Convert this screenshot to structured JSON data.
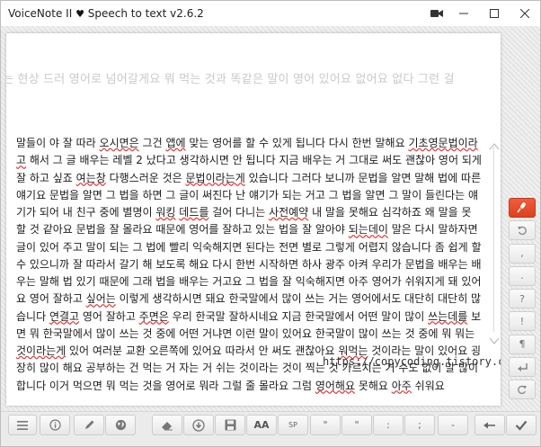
{
  "window": {
    "title_prefix": "VoiceNote II",
    "heart": "♥",
    "title_suffix": "Speech to text v2.6.2"
  },
  "editor": {
    "ghost_line": "는 현상 드러 영어로 넘어갈게요 뭐 먹는 것과 똑같은 말이 영어 있어요 없어요 없다 그런 걸",
    "segments": [
      {
        "t": "말들이 야 잘 따라 ",
        "sq": false
      },
      {
        "t": "오시면은",
        "sq": true
      },
      {
        "t": " 그건 ",
        "sq": false
      },
      {
        "t": "앱에",
        "sq": true
      },
      {
        "t": " 맞는 영어를 할 수 있게 됩니다 다시 한번 말해요 ",
        "sq": false
      },
      {
        "t": "기초영문법이라고",
        "sq": true
      },
      {
        "t": " 해서 그 글 배우는 레벨 2 났다고 생각하시면 안 됩니다 지금 배우는 거 그대로 써도 괜찮아 영어 되게 잘 하고 싶죠 ",
        "sq": false
      },
      {
        "t": "여는창",
        "sq": true
      },
      {
        "t": " 다행스러운 것은 ",
        "sq": false
      },
      {
        "t": "문법이라는게",
        "sq": true
      },
      {
        "t": " 있습니다 그러다 보니까 문법을 알면 말해 법에 따른 얘기요 문법을 알면 그 법을 하면 그 글이 써진다 난 얘기가 되는 거고 그 법을 알면 그 말이 들린다는 얘기가 되어 내 친구 중에 별명이 ",
        "sq": false
      },
      {
        "t": "워킹",
        "sq": true
      },
      {
        "t": " ",
        "sq": false
      },
      {
        "t": "데드를",
        "sq": true
      },
      {
        "t": " 걸어 다니는 ",
        "sq": false
      },
      {
        "t": "사전예약",
        "sq": true
      },
      {
        "t": " 내 말을 못해요 심각하죠 왜 말을 못 할 것 같아요 문법을 잘 몰라요 때문에 영어를 잘하고 있는 법을 잘 알아야 ",
        "sq": false
      },
      {
        "t": "되는데이",
        "sq": true
      },
      {
        "t": " 말은 다시 말하자면 글이 있어 주고 말이 되는 그 법에 빨리 익숙해지면 된다는 전면 별로 그렇게 어렵지 않습니다 좀 쉽게 할 수 있으니까 잘 따라서 갈기 해 보도록 해요 다시 한번 시작하면 하사 광주 아켜 우리가 문법을 배우는 배우는 말해 법 있기 때문에 그래 법을 배우는 거고요 그 법을 잘 익숙해지면 아주 영어가 쉬워지게 돼 있어요 영어 잘하고 ",
        "sq": false
      },
      {
        "t": "싶어는",
        "sq": true
      },
      {
        "t": " 이렇게 생각하시면 돼요 한국말에서 많이 쓰는 거는 영어에서도 대단히 대단히 많습니다 ",
        "sq": false
      },
      {
        "t": "연결고",
        "sq": true
      },
      {
        "t": " 영어 잘하고 ",
        "sq": false
      },
      {
        "t": "주면은",
        "sq": true
      },
      {
        "t": " 우리 한국말 잘하시네요 지금 한국말에서 어떤 말이 많이 ",
        "sq": false
      },
      {
        "t": "쓰는데를",
        "sq": true
      },
      {
        "t": " 보면 뭐 한국말에서 많이 쓰는 것 중에 어떤 거냐면 이런 말이 있어요 한국말이 많이 쓰는 것 중에 뭐 뭐는 ",
        "sq": false
      },
      {
        "t": "것이라는게",
        "sq": true
      },
      {
        "t": " 있어 여러분 교환 오른쪽에 있어요 따라서 안 써도 괜찮아요 ",
        "sq": false
      },
      {
        "t": "워먹는",
        "sq": true
      },
      {
        "t": " 것이라는 말이 있어요 굉장히 많이 해요 공부하는 건 먹는 거 자는 거 쉬는 것이라는 것이 찍는 것 가르치는 거 수도 없이 말 많이 합니다 이거 먹으면 뭐 먹는 것을 영어로 뭐라 그럴 줄 몰라요 그럼 ",
        "sq": false
      },
      {
        "t": "영어해요",
        "sq": true
      },
      {
        "t": " 못해요 ",
        "sq": false
      },
      {
        "t": "아주",
        "sq": true
      },
      {
        "t": " 쉬워요",
        "sq": false
      }
    ],
    "url": "https://copycoding.tistory.com/"
  },
  "sidebar": {
    "buttons": [
      {
        "name": "microphone-button",
        "icon": "microphone-icon",
        "label": ""
      },
      {
        "name": "undo-button",
        "icon": "undo-icon",
        "label": ""
      },
      {
        "name": "comma-button",
        "icon": "",
        "label": ","
      },
      {
        "name": "period-button",
        "icon": "",
        "label": "."
      },
      {
        "name": "question-button",
        "icon": "",
        "label": "?"
      },
      {
        "name": "exclamation-button",
        "icon": "",
        "label": "!"
      },
      {
        "name": "paragraph-button",
        "icon": "",
        "label": "¶"
      },
      {
        "name": "enter-button",
        "icon": "enter-icon",
        "label": ""
      },
      {
        "name": "redo-button",
        "icon": "redo-icon",
        "label": ""
      }
    ]
  },
  "toolbar": {
    "buttons": [
      {
        "name": "menu-button",
        "icon": "menu-icon",
        "label": ""
      },
      {
        "name": "info-button",
        "icon": "info-icon",
        "label": ""
      },
      {
        "name": "pen-button",
        "icon": "pen-icon",
        "label": ""
      },
      {
        "name": "globe-button",
        "icon": "globe-icon",
        "label": ""
      },
      {
        "name": "eraser-button",
        "icon": "eraser-icon",
        "label": ""
      },
      {
        "name": "download-button",
        "icon": "download-icon",
        "label": ""
      },
      {
        "name": "save-button",
        "icon": "save-icon",
        "label": ""
      },
      {
        "name": "font-size-button",
        "icon": "",
        "label": "AA"
      },
      {
        "name": "space-button",
        "icon": "",
        "label": "SP"
      },
      {
        "name": "quote-button",
        "icon": "",
        "label": "\""
      },
      {
        "name": "double-quote-button",
        "icon": "",
        "label": "\""
      },
      {
        "name": "colon-button",
        "icon": "",
        "label": ":"
      },
      {
        "name": "semicolon-button",
        "icon": "",
        "label": ";"
      },
      {
        "name": "dash-button",
        "icon": "",
        "label": "-"
      },
      {
        "name": "backspace-button",
        "icon": "backspace-icon",
        "label": ""
      },
      {
        "name": "check-button",
        "icon": "check-icon",
        "label": ""
      }
    ]
  },
  "colors": {
    "mic_accent": "#e34d2a",
    "spellcheck": "#e03b3b"
  }
}
